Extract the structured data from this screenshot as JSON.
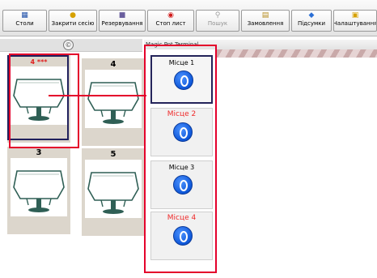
{
  "toolbar": {
    "buttons": [
      {
        "label": "Столи",
        "icon": "grid-icon",
        "enabled": true
      },
      {
        "label": "Закрити сесію",
        "icon": "lock-icon",
        "enabled": true
      },
      {
        "label": "Резервування",
        "icon": "reservation-icon",
        "enabled": true
      },
      {
        "label": "Стоп лист",
        "icon": "stop-icon",
        "enabled": true
      },
      {
        "label": "Пошук",
        "icon": "search-icon",
        "enabled": false
      },
      {
        "label": "Замовлення",
        "icon": "order-icon",
        "enabled": true
      },
      {
        "label": "Підсумки",
        "icon": "summary-icon",
        "enabled": true
      },
      {
        "label": "Налаштування",
        "icon": "settings-icon",
        "enabled": true
      }
    ]
  },
  "tables": [
    {
      "number": "4 ***",
      "selected": true,
      "highlighted": true
    },
    {
      "number": "4",
      "selected": false,
      "highlighted": false
    },
    {
      "number": "3",
      "selected": false,
      "highlighted": false
    },
    {
      "number": "5",
      "selected": false,
      "highlighted": false
    }
  ],
  "panel": {
    "title": "Magic Pot Terminal",
    "seats": [
      {
        "label": "Місце 1",
        "active": true,
        "label_color": "#000000"
      },
      {
        "label": "Місце 2",
        "active": false,
        "label_color": "#ef2a2a"
      },
      {
        "label": "Місце 3",
        "active": false,
        "label_color": "#000000"
      },
      {
        "label": "Місце 4",
        "active": false,
        "label_color": "#ef2a2a"
      }
    ]
  },
  "colors": {
    "annotation_red": "#e4002b",
    "selection_navy": "#24245a",
    "pot_blue": "#0e57d8"
  }
}
